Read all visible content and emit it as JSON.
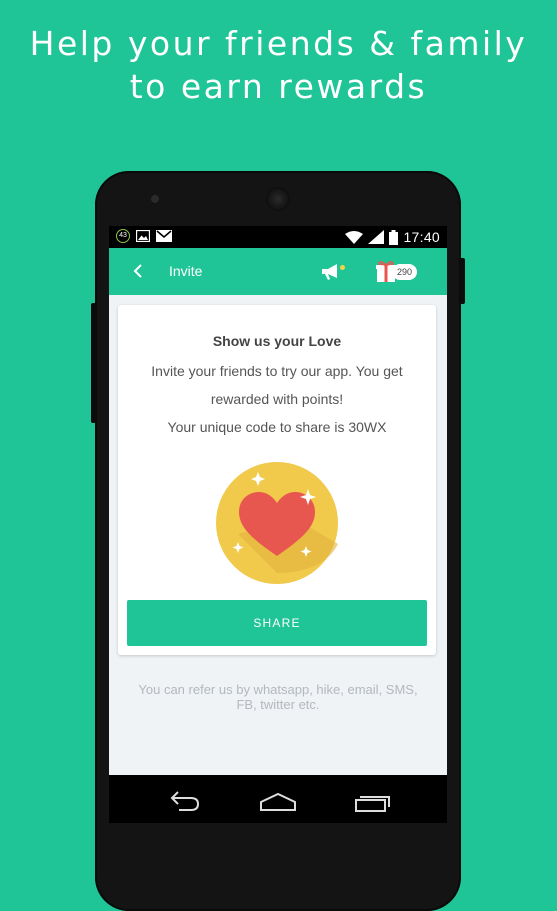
{
  "headline": {
    "line1": "Help your friends & family",
    "line2": "to earn rewards"
  },
  "status_bar": {
    "notification_count": "43",
    "time": "17:40",
    "icons": [
      "notification-count-icon",
      "image-icon",
      "gmail-icon",
      "wifi-icon",
      "signal-icon",
      "battery-icon"
    ]
  },
  "app_bar": {
    "title": "Invite",
    "points": "290",
    "icons": [
      "back-arrow-icon",
      "megaphone-icon",
      "gift-icon"
    ]
  },
  "card": {
    "title": "Show us your Love",
    "line1": "Invite your friends to try our app. You get",
    "line2": "rewarded with points!",
    "line3": "Your unique code to share is 30WX",
    "illustration": "heart-badge-icon",
    "share_label": "SHARE"
  },
  "footer_note": {
    "line1": "You can refer us by whatsapp, hike, email, SMS,",
    "line2": "FB, twitter etc."
  },
  "nav_bar": {
    "icons": [
      "back-icon",
      "home-icon",
      "recents-icon"
    ]
  },
  "colors": {
    "brand_green": "#1fc497",
    "heart_red": "#e8574f",
    "badge_yellow": "#f1c94b",
    "notification_dot": "#f5d442"
  }
}
